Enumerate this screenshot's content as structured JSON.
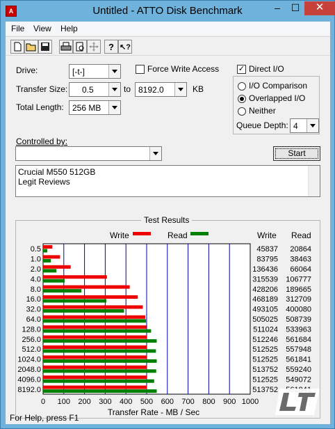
{
  "window": {
    "title": "Untitled - ATTO Disk Benchmark",
    "app_icon": "atto-icon"
  },
  "title_buttons": {
    "minimize": "–",
    "maximize": "☐",
    "close": "✕"
  },
  "menu": [
    "File",
    "View",
    "Help"
  ],
  "toolbar_icons": [
    "new-file-icon",
    "open-folder-icon",
    "save-icon",
    "print-icon",
    "print-preview-icon",
    "move-icon",
    "help-icon",
    "context-help-icon"
  ],
  "form": {
    "drive_label": "Drive:",
    "drive_value": "[-t-]",
    "force_write_label": "Force Write Access",
    "direct_io_label": "Direct I/O",
    "transfer_size_label": "Transfer Size:",
    "transfer_from": "0.5",
    "to_label": "to",
    "transfer_to": "8192.0",
    "kb_label": "KB",
    "total_length_label": "Total Length:",
    "total_length_value": "256 MB",
    "io_comparison_label": "I/O Comparison",
    "overlapped_io_label": "Overlapped I/O",
    "neither_label": "Neither",
    "queue_depth_label": "Queue Depth:",
    "queue_depth_value": "4",
    "controlled_by_label": "Controlled by:",
    "controlled_by_value": "",
    "start_label": "Start",
    "notes_line1": "Crucial M550 512GB",
    "notes_line2": "Legit Reviews",
    "direct_io_checked": true,
    "force_write_checked": false,
    "selected_mode": "Overlapped I/O"
  },
  "results": {
    "title": "Test Results",
    "write_legend": "Write",
    "read_legend": "Read",
    "write_col": "Write",
    "read_col": "Read",
    "xlabel": "Transfer Rate - MB / Sec",
    "write_color": "#ee0000",
    "read_color": "#008000"
  },
  "chart_data": {
    "type": "bar",
    "categories": [
      "0.5",
      "1.0",
      "2.0",
      "4.0",
      "8.0",
      "16.0",
      "32.0",
      "64.0",
      "128.0",
      "256.0",
      "512.0",
      "1024.0",
      "2048.0",
      "4096.0",
      "8192.0"
    ],
    "series": [
      {
        "name": "Write",
        "values": [
          45837,
          83795,
          136436,
          315539,
          428206,
          468189,
          493105,
          505025,
          511024,
          512246,
          512525,
          512525,
          513752,
          512525,
          513752
        ]
      },
      {
        "name": "Read",
        "values": [
          20864,
          38463,
          66064,
          106777,
          189665,
          312709,
          400080,
          508739,
          533963,
          561684,
          557948,
          561841,
          559240,
          549072,
          561841
        ]
      }
    ],
    "x_ticks": [
      "0",
      "100",
      "200",
      "300",
      "400",
      "500",
      "600",
      "700",
      "800",
      "900",
      "1000"
    ],
    "xlim": [
      0,
      1000
    ],
    "xlabel": "Transfer Rate - MB / Sec",
    "grid": true
  },
  "status": {
    "text": "For Help, press F1"
  },
  "watermark": {
    "text": "LEGIT REVIEWS"
  }
}
